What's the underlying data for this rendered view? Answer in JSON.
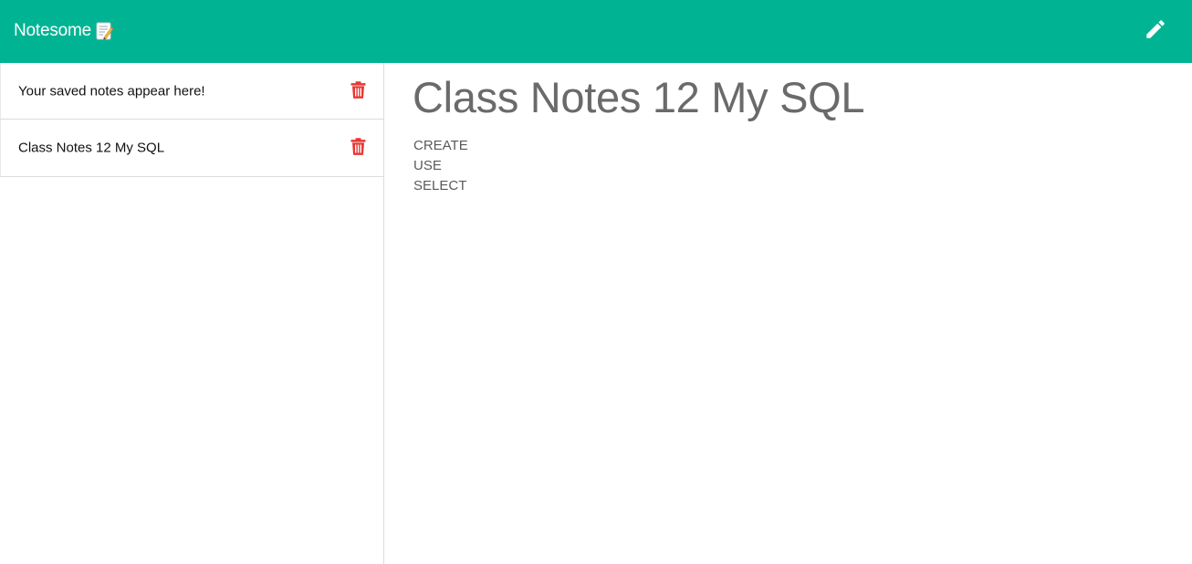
{
  "header": {
    "brand": "Notesome",
    "brand_icon": "memo-icon",
    "new_note_icon": "pencil-icon",
    "color": "#00b493"
  },
  "sidebar": {
    "items": [
      {
        "title": "Your saved notes appear here!",
        "delete_icon": "trash-icon"
      },
      {
        "title": "Class Notes 12 My SQL",
        "delete_icon": "trash-icon"
      }
    ]
  },
  "note": {
    "title": "Class Notes 12 My SQL",
    "lines": [
      "CREATE",
      "USE",
      "SELECT"
    ]
  },
  "colors": {
    "accent": "#00b493",
    "delete": "#e53935"
  }
}
